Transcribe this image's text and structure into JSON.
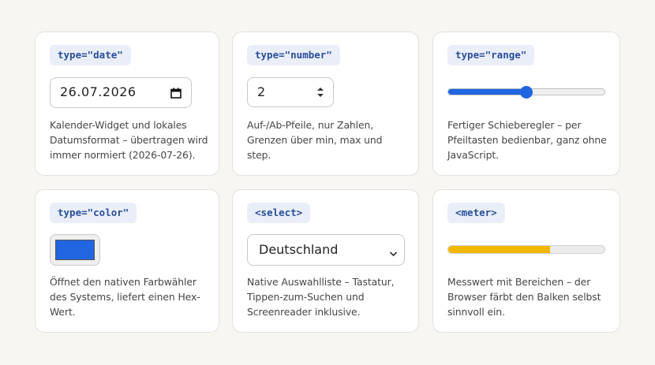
{
  "cards": {
    "date": {
      "tag": "type=\"date\"",
      "value": "26.07.2026",
      "icon": "calendar-icon",
      "description": "Kalender-Widget und lokales Datumsformat – übertragen wird immer normiert (2026-07-26)."
    },
    "number": {
      "tag": "type=\"number\"",
      "value": "2",
      "icon": "spinner-arrows-icon",
      "description": "Auf-/Ab-Pfeile, nur Zahlen, Grenzen über min, max und step."
    },
    "range": {
      "tag": "type=\"range\"",
      "value_fraction": 0.5,
      "accent_color": "#2166e0",
      "description": "Fertiger Schieberegler – per Pfeiltasten bedienbar, ganz ohne JavaScript."
    },
    "color": {
      "tag": "type=\"color\"",
      "value": "#2166e0",
      "description": "Öffnet den nativen Farbwähler des Systems, liefert einen Hex-Wert."
    },
    "select": {
      "tag": "<select>",
      "selected": "Deutschland",
      "icon": "chevron-down-icon",
      "description": "Native Auswahlliste – Tastatur, Tippen-zum-Suchen und Screenreader inklusive."
    },
    "meter": {
      "tag": "<meter>",
      "value_fraction": 0.65,
      "fill_color": "#f2b705",
      "description": "Messwert mit Bereichen – der Browser färbt den Balken selbst sinnvoll ein."
    }
  }
}
